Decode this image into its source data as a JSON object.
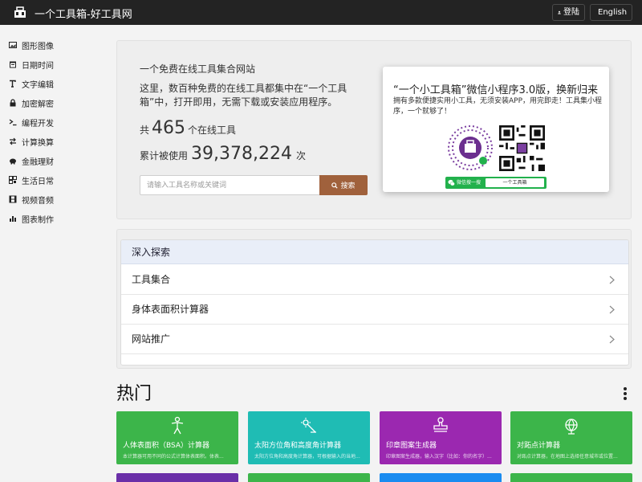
{
  "topbar": {
    "title": "一个工具箱-好工具网",
    "login_label": "登陆",
    "lang_label": "English",
    "bg_color": "#232323"
  },
  "sidebar": {
    "items": [
      {
        "label": "图形图像",
        "icon": "image-icon"
      },
      {
        "label": "日期时间",
        "icon": "calendar-icon"
      },
      {
        "label": "文字编辑",
        "icon": "text-icon"
      },
      {
        "label": "加密解密",
        "icon": "lock-icon"
      },
      {
        "label": "编程开发",
        "icon": "terminal-icon"
      },
      {
        "label": "计算换算",
        "icon": "exchange-icon"
      },
      {
        "label": "金融理财",
        "icon": "piggy-bank-icon"
      },
      {
        "label": "生活日常",
        "icon": "qrcode-icon"
      },
      {
        "label": "视频音频",
        "icon": "film-icon"
      },
      {
        "label": "图表制作",
        "icon": "bar-chart-icon"
      }
    ]
  },
  "hero": {
    "subtitle": "一个免费在线工具集合网站",
    "description": "这里，数百种免费的在线工具都集中在“一个工具箱”中，打开即用，无需下载或安装应用程序。",
    "count_prefix": "共",
    "count_value": "465",
    "count_suffix": "个在线工具",
    "usage_prefix": "累计被使用",
    "usage_value": "39,378,224",
    "usage_suffix": "次",
    "search_placeholder": "请输入工具名称或关键词",
    "search_button": "搜索",
    "search_button_color": "#a0613c"
  },
  "promo": {
    "title": "“一个小工具箱”微信小程序3.0版，换新归来",
    "description": "拥有多款便捷实用小工具，无须安装APP，用完即走！工具集小程序，一个就够了！",
    "wx_left": "微信搜一搜",
    "wx_right": "一个工具箱",
    "wx_color": "#22b14c"
  },
  "explore": {
    "header": "深入探索",
    "items": [
      "工具集合",
      "身体表面积计算器",
      "网站推广"
    ]
  },
  "hot": {
    "title": "热门",
    "cards": [
      {
        "title": "人体表面积（BSA）计算器",
        "desc": "本计算器可用不同的公式计算体表面积。体表...",
        "color": "#3cb54a",
        "icon": "person-icon"
      },
      {
        "title": "太阳方位角和高度角计算器",
        "desc": "太阳方位角和高度角计算器，可根据输入的当地...",
        "color": "#1fbcb4",
        "icon": "sun-angle-icon"
      },
      {
        "title": "印章图案生成器",
        "desc": "印章图案生成器，输入汉字（比如：你的名字）...",
        "color": "#9b28b0",
        "icon": "stamp-icon"
      },
      {
        "title": "对跖点计算器",
        "desc": "对跖点计算器，在地图上选择任意城市或位置...",
        "color": "#3cb54a",
        "icon": "globe-icon"
      }
    ],
    "row2_colors": [
      "#6a2fa8",
      "#3cb54a",
      "#1a8cf0",
      "#3cb54a"
    ]
  }
}
